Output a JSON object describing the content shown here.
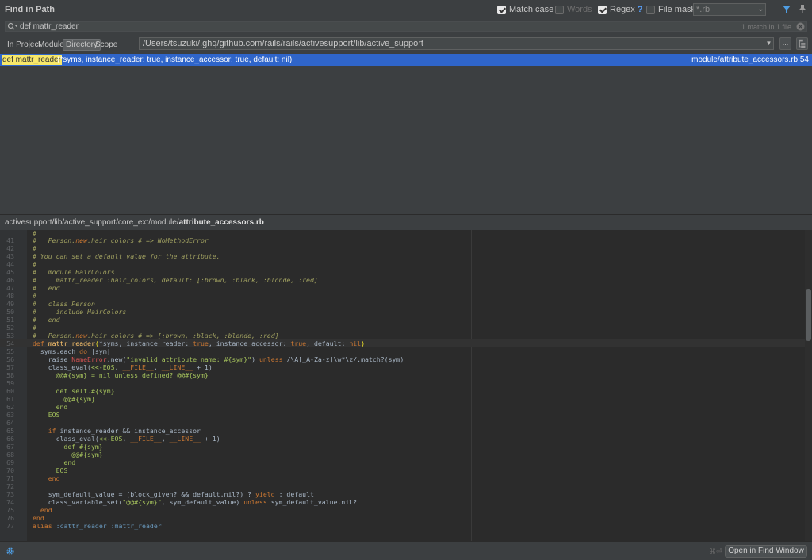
{
  "header": {
    "title": "Find in Path",
    "match_case": {
      "label": "Match case",
      "checked": true
    },
    "words": {
      "label": "Words",
      "checked": false
    },
    "regex": {
      "label": "Regex",
      "help": "?",
      "checked": true
    },
    "file_mask": {
      "label": "File mask:",
      "checked": false,
      "value": "*.rb"
    }
  },
  "search": {
    "query": "def mattr_reader",
    "match_info": "1 match in 1 file"
  },
  "scope": {
    "tabs": [
      "In Project",
      "Module",
      "Directory",
      "Scope"
    ],
    "selected": "Directory",
    "directory": "/Users/tsuzuki/.ghq/github.com/rails/rails/activesupport/lib/active_support",
    "browse_label": "..."
  },
  "results": [
    {
      "match": "def mattr_reader",
      "rest": "(*syms, instance_reader: true, instance_accessor: true, default: nil)",
      "file": "module/attribute_accessors.rb 54"
    }
  ],
  "preview": {
    "path_prefix": "activesupport/lib/active_support/core_ext/module/",
    "path_file": "attribute_accessors.rb",
    "first_line_marker": "#",
    "line_numbers": [
      "41",
      "42",
      "43",
      "44",
      "45",
      "46",
      "47",
      "48",
      "49",
      "50",
      "51",
      "52",
      "53",
      "54",
      "55",
      "56",
      "57",
      "58",
      "59",
      "60",
      "61",
      "62",
      "63",
      "64",
      "65",
      "66",
      "67",
      "68",
      "69",
      "70",
      "71",
      "72",
      "73",
      "74",
      "75",
      "76",
      "77"
    ]
  },
  "footer": {
    "shortcut": "⌘⏎",
    "open_button": "Open in Find Window"
  },
  "colors": {
    "selection": "#2f65ca",
    "match_highlight": "#f7e86a",
    "editor_bg": "#2b2b2b",
    "panel_bg": "#3c3f41"
  },
  "icons": [
    "search-icon",
    "clear-icon",
    "filter-icon",
    "pin-icon",
    "gear-icon",
    "recursive-icon",
    "dropdown-icon"
  ]
}
